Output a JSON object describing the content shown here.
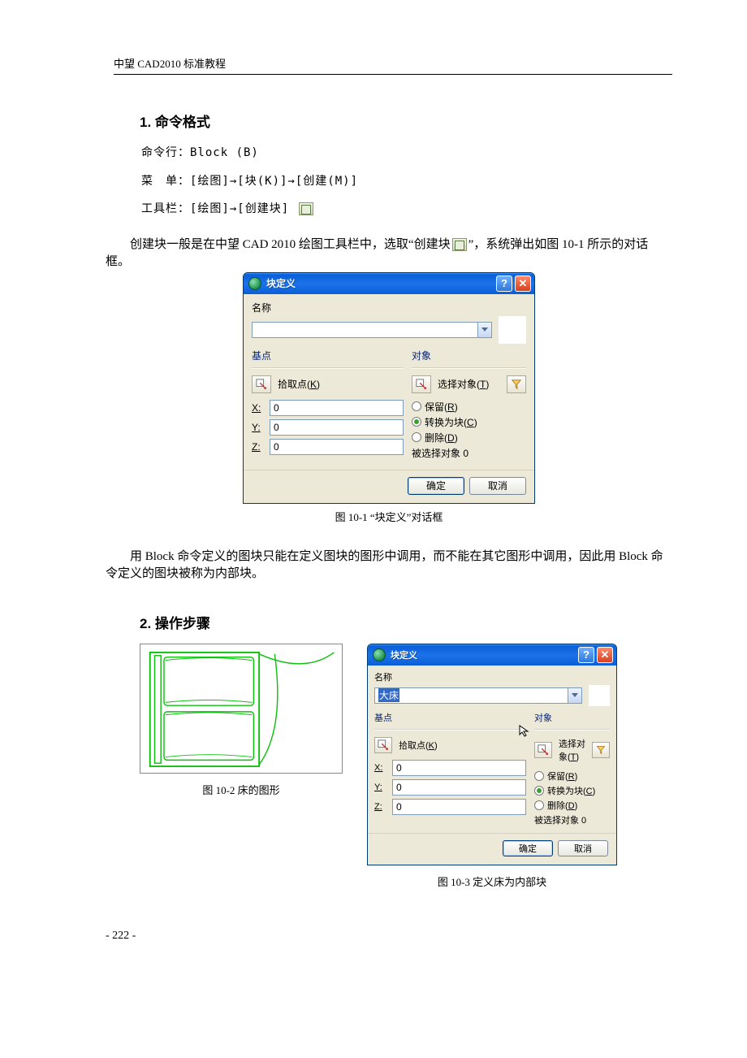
{
  "header": "中望 CAD2010 标准教程",
  "sec1_title": "1. 命令格式",
  "cmd_line": "命令行：Block (B)",
  "menu_line": "菜　单：[绘图]→[块(K)]→[创建(M)]",
  "toolbar_line": "工具栏：[绘图]→[创建块]",
  "para1a": "创建块一般是在中望 CAD 2010 绘图工具栏中，选取“创建块",
  "para1b": "”，系统弹出如图 10-1 所示的对话框。",
  "para2": "用 Block 命令定义的图块只能在定义图块的图形中调用，而不能在其它图形中调用，因此用 Block 命令定义的图块被称为内部块。",
  "sec2_title": "2. 操作步骤",
  "caption1": "图 10-1  “块定义”对话框",
  "caption2": "图 10-2  床的图形",
  "caption3": "图 10-3  定义床为内部块",
  "page_number": "- 222 -",
  "dialog": {
    "title": "块定义",
    "name_label": "名称",
    "name_value": "",
    "name_value2": "大床",
    "group_base": "基点",
    "pick_point": "拾取点",
    "pick_key": "K",
    "x_label": "X:",
    "y_label": "Y:",
    "z_label": "Z:",
    "x_val": "0",
    "y_val": "0",
    "z_val": "0",
    "group_obj": "对象",
    "select_obj": "选择对象",
    "select_key": "T",
    "retain": "保留",
    "retain_key": "R",
    "convert": "转换为块",
    "convert_key": "C",
    "delete": "删除",
    "delete_key": "D",
    "selected_text": "被选择对象  0",
    "ok": "确定",
    "cancel": "取消"
  }
}
